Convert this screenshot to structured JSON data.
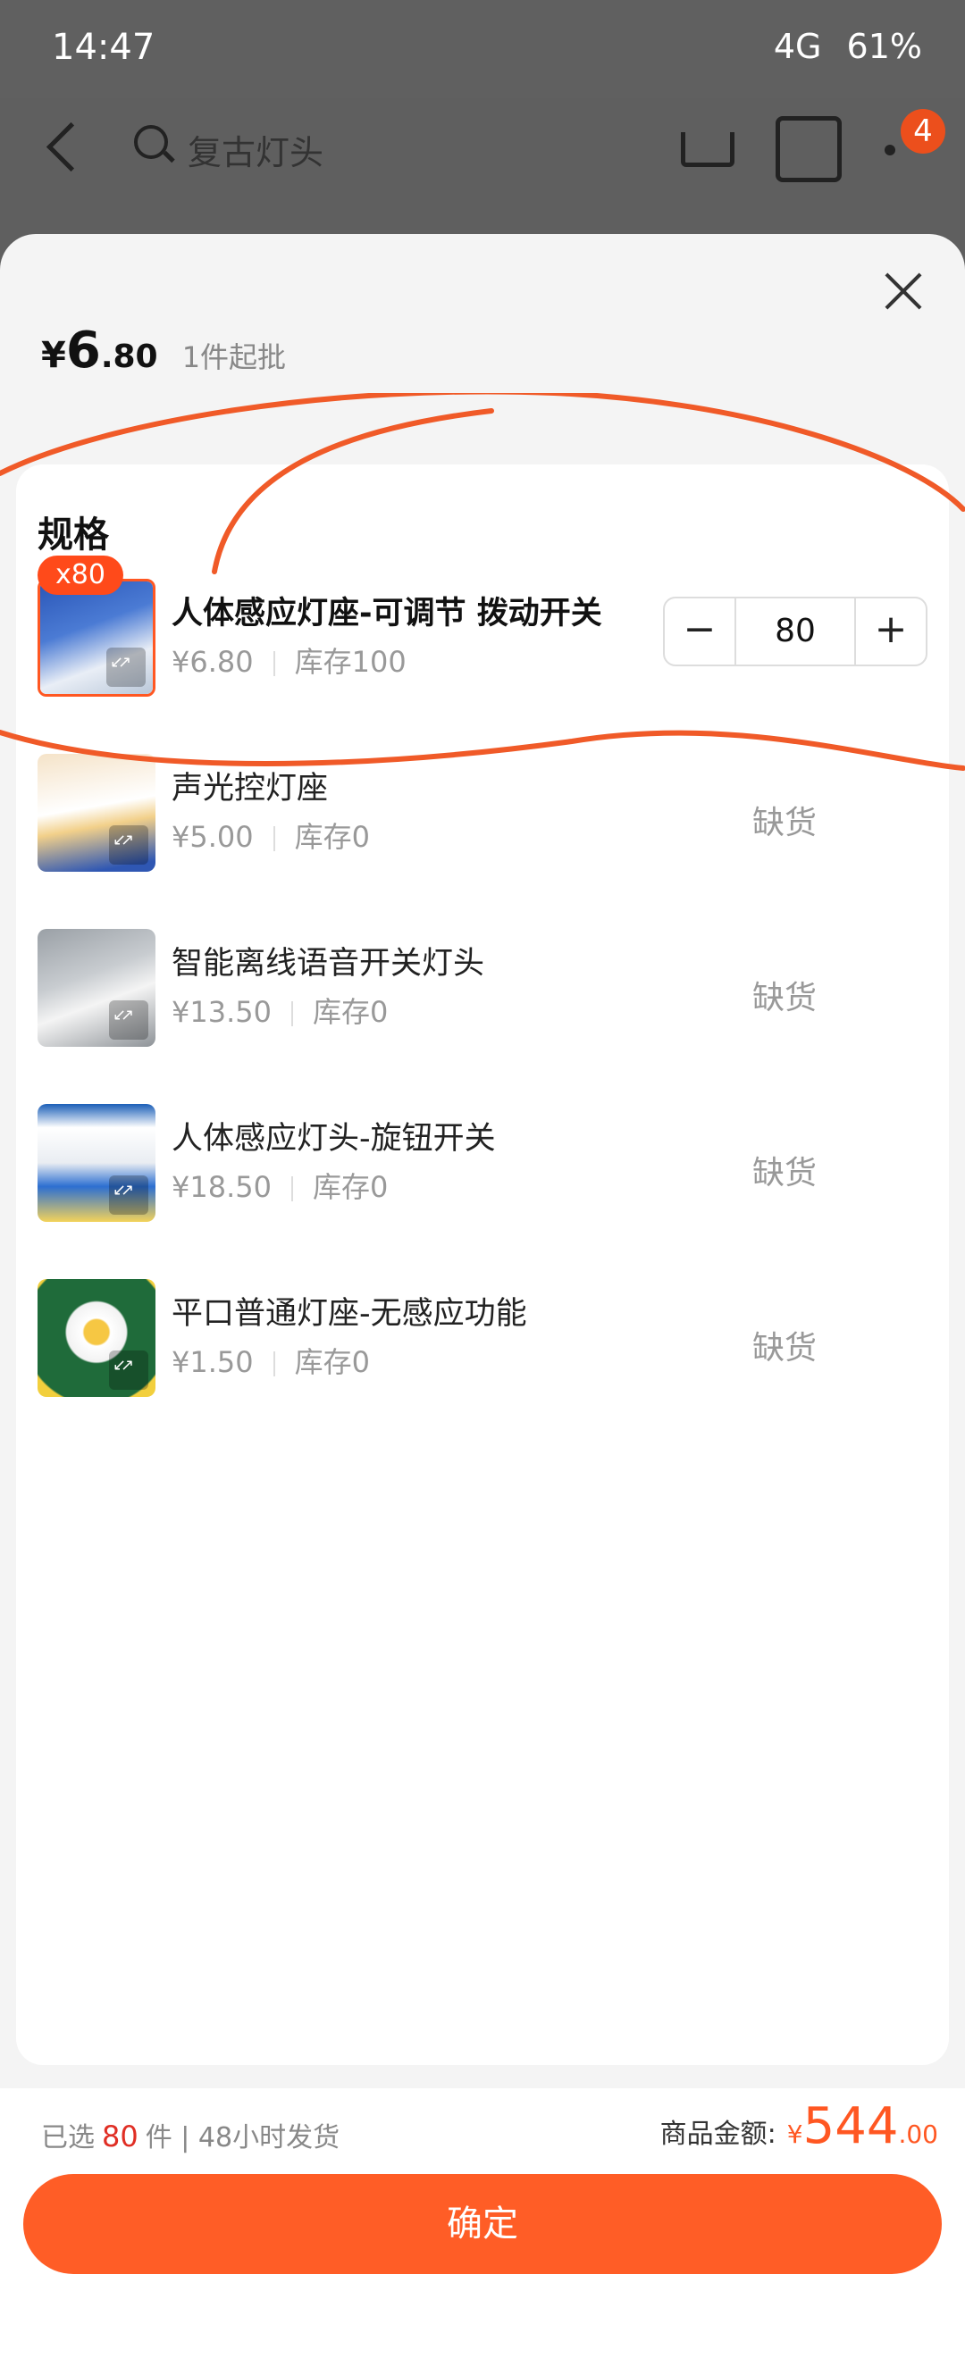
{
  "status_bar": {
    "time": "14:47",
    "network": "4G",
    "battery": "61%"
  },
  "nav": {
    "search_placeholder": "复古灯头",
    "cart_badge": "4"
  },
  "sheet": {
    "price": {
      "currency": "¥",
      "integer": "6",
      "decimal": ".80"
    },
    "moq": "1件起批",
    "spec_title": "规格",
    "items": [
      {
        "name": "人体感应灯座-可调节  拨动开关",
        "price": "¥6.80",
        "stock": "库存100",
        "selected_qty_badge": "x80",
        "quantity": "80",
        "status": ""
      },
      {
        "name": "声光控灯座",
        "price": "¥5.00",
        "stock": "库存0",
        "status": "缺货"
      },
      {
        "name": "智能离线语音开关灯头",
        "price": "¥13.50",
        "stock": "库存0",
        "status": "缺货"
      },
      {
        "name": "人体感应灯头-旋钮开关",
        "price": "¥18.50",
        "stock": "库存0",
        "status": "缺货"
      },
      {
        "name": "平口普通灯座-无感应功能",
        "price": "¥1.50",
        "stock": "库存0",
        "status": "缺货"
      }
    ],
    "stepper_minus": "−",
    "stepper_plus": "+"
  },
  "footer": {
    "selected_prefix": "已选",
    "selected_count": "80",
    "selected_suffix": "件 | 48小时发货",
    "total_label": "商品金额:",
    "total_currency": "¥",
    "total_integer": "544",
    "total_decimal": ".00",
    "confirm_label": "确定"
  },
  "colors": {
    "accent": "#ff5d26",
    "price_red": "#e02e24",
    "annotation": "#f05a28"
  }
}
